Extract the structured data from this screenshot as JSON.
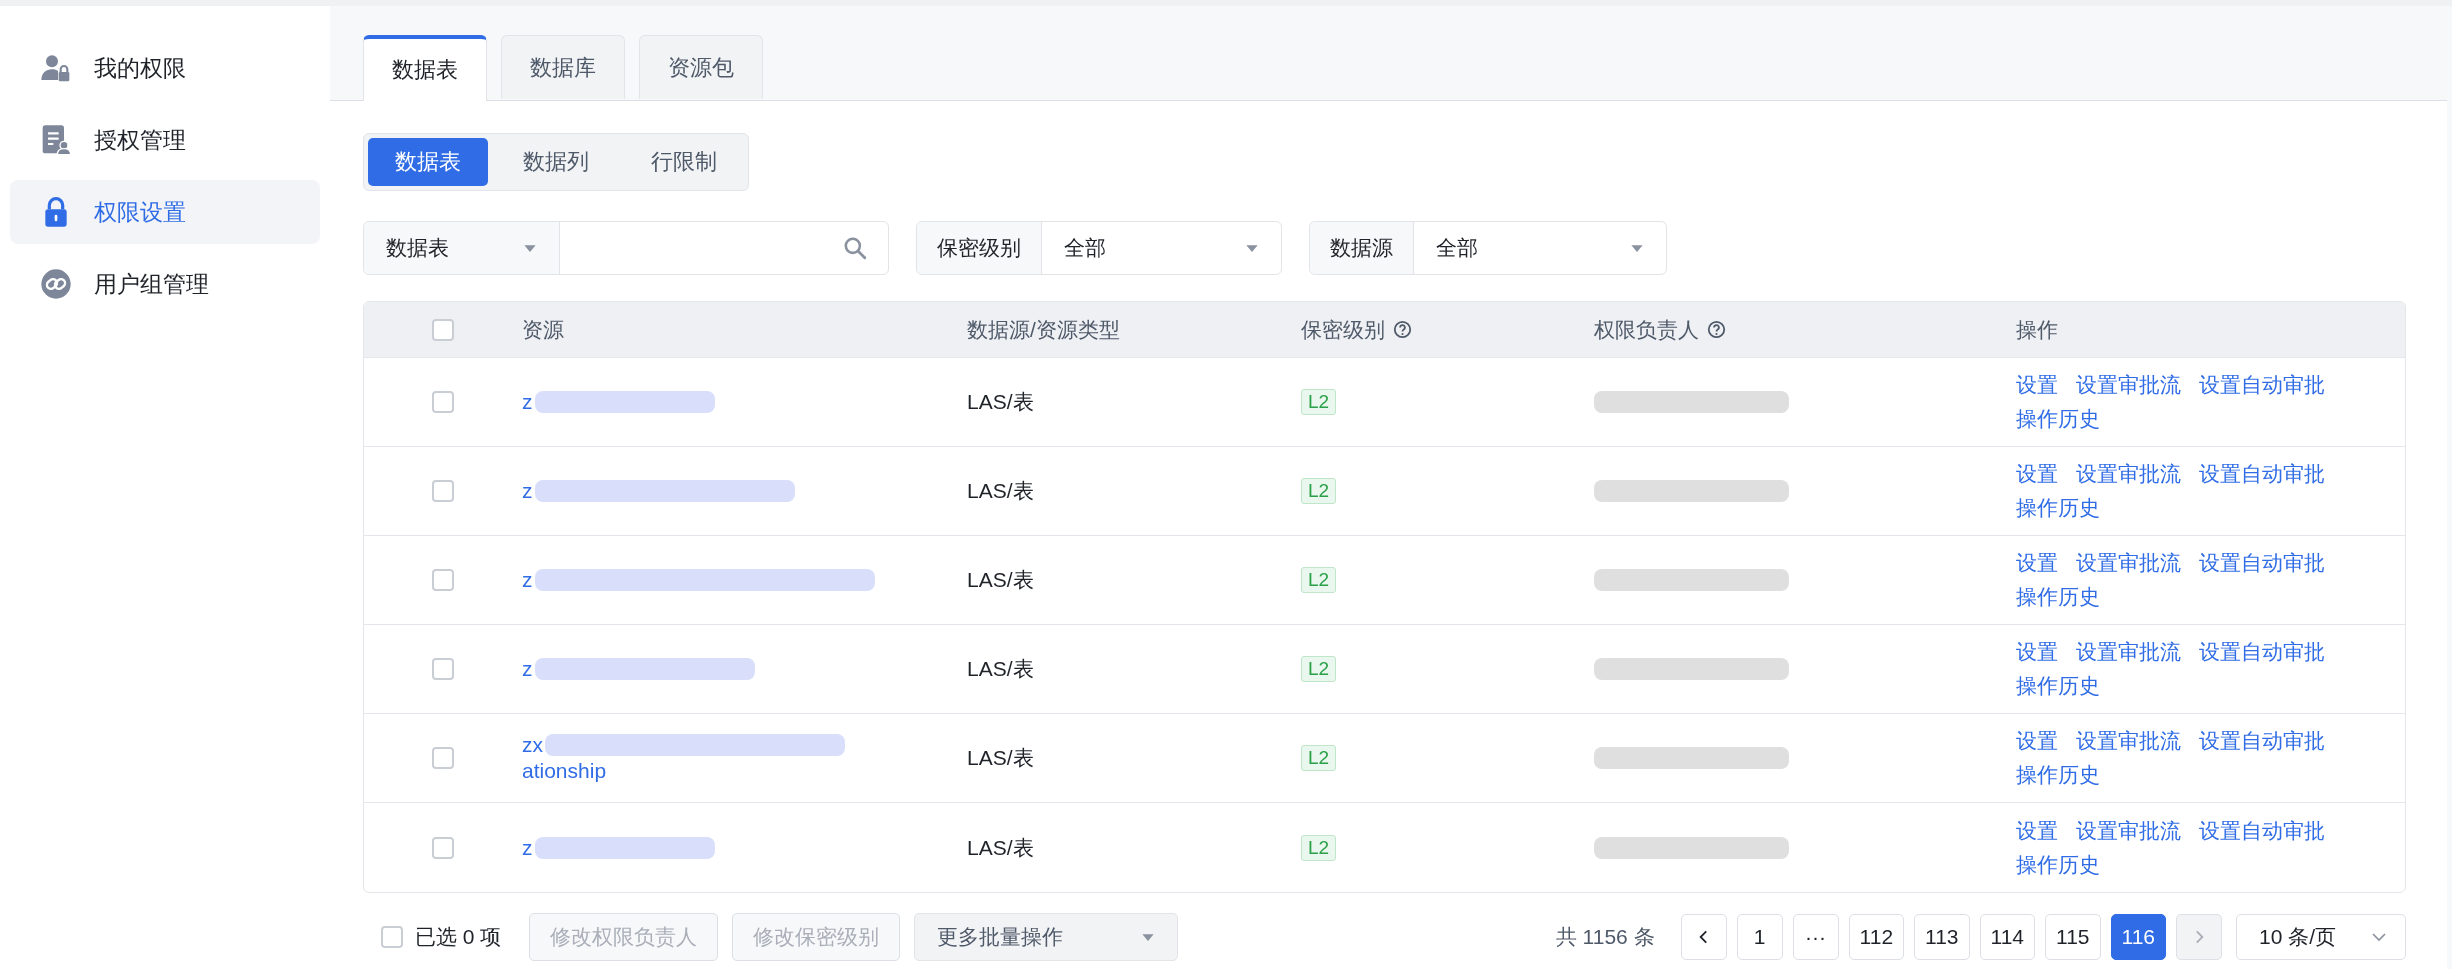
{
  "sidebar": {
    "items": [
      {
        "label": "我的权限",
        "selected": false
      },
      {
        "label": "授权管理",
        "selected": false
      },
      {
        "label": "权限设置",
        "selected": true
      },
      {
        "label": "用户组管理",
        "selected": false
      }
    ]
  },
  "tabs": [
    {
      "label": "数据表",
      "selected": true
    },
    {
      "label": "数据库",
      "selected": false
    },
    {
      "label": "资源包",
      "selected": false
    }
  ],
  "segments": [
    {
      "label": "数据表",
      "selected": true
    },
    {
      "label": "数据列",
      "selected": false
    },
    {
      "label": "行限制",
      "selected": false
    }
  ],
  "filters": {
    "search": {
      "type_select": "数据表"
    },
    "selects": [
      {
        "label": "保密级别",
        "value": "全部"
      },
      {
        "label": "数据源",
        "value": "全部"
      }
    ]
  },
  "table": {
    "header_checked": false,
    "columns": [
      {
        "label": "资源",
        "help": false
      },
      {
        "label": "数据源/资源类型",
        "help": false
      },
      {
        "label": "保密级别",
        "help": true
      },
      {
        "label": "权限负责人",
        "help": true
      },
      {
        "label": "操作",
        "help": false
      }
    ],
    "rows": [
      {
        "checked": false,
        "resource": [
          "z"
        ],
        "blurred": true,
        "type": "LAS/表",
        "level": "L2",
        "owner_blurred": true,
        "actions": [
          "设置",
          "设置审批流",
          "设置自动审批",
          "操作历史"
        ]
      },
      {
        "checked": false,
        "resource": [
          "z"
        ],
        "blurred": true,
        "type": "LAS/表",
        "level": "L2",
        "owner_blurred": true,
        "actions": [
          "设置",
          "设置审批流",
          "设置自动审批",
          "操作历史"
        ]
      },
      {
        "checked": false,
        "resource": [
          "z"
        ],
        "blurred": true,
        "type": "LAS/表",
        "level": "L2",
        "owner_blurred": true,
        "actions": [
          "设置",
          "设置审批流",
          "设置自动审批",
          "操作历史"
        ]
      },
      {
        "checked": false,
        "resource": [
          "z"
        ],
        "blurred": true,
        "type": "LAS/表",
        "level": "L2",
        "owner_blurred": true,
        "actions": [
          "设置",
          "设置审批流",
          "设置自动审批",
          "操作历史"
        ]
      },
      {
        "checked": false,
        "resource": [
          "zx",
          "ationship"
        ],
        "blurred": true,
        "type": "LAS/表",
        "level": "L2",
        "owner_blurred": true,
        "actions": [
          "设置",
          "设置审批流",
          "设置自动审批",
          "操作历史"
        ]
      },
      {
        "checked": false,
        "resource": [
          "z"
        ],
        "blurred": true,
        "type": "LAS/表",
        "level": "L2",
        "owner_blurred": true,
        "actions": [
          "设置",
          "设置审批流",
          "设置自动审批",
          "操作历史"
        ]
      }
    ]
  },
  "footer": {
    "select_all": {
      "checked": false,
      "label": "已选 0 项"
    },
    "buttons": [
      {
        "label": "修改权限负责人",
        "disabled": true
      },
      {
        "label": "修改保密级别",
        "disabled": true
      }
    ],
    "more": "更多批量操作",
    "total": "共 1156 条",
    "pages": [
      {
        "label": "1",
        "selected": false
      },
      {
        "label": "···",
        "selected": false
      },
      {
        "label": "112",
        "selected": false
      },
      {
        "label": "113",
        "selected": false
      },
      {
        "label": "114",
        "selected": false
      },
      {
        "label": "115",
        "selected": false
      },
      {
        "label": "116",
        "selected": true
      }
    ],
    "prev_disabled": false,
    "next_disabled": true,
    "page_size": "10 条/页"
  }
}
